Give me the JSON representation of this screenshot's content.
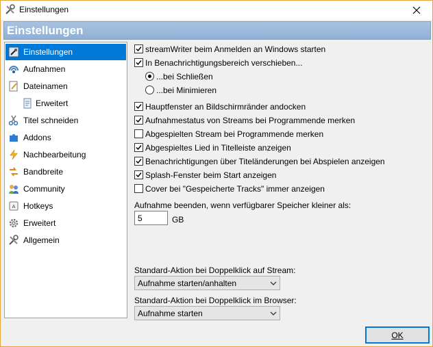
{
  "window": {
    "title": "Einstellungen",
    "close_label": "Close"
  },
  "banner": {
    "title": "Einstellungen"
  },
  "sidebar": {
    "items": [
      {
        "label": "Einstellungen",
        "icon": "settings-icon",
        "selected": true
      },
      {
        "label": "Aufnahmen",
        "icon": "recording-icon"
      },
      {
        "label": "Dateinamen",
        "icon": "filename-icon"
      },
      {
        "label": "Erweitert",
        "icon": "advanced-file-icon",
        "sub": true
      },
      {
        "label": "Titel schneiden",
        "icon": "scissors-icon"
      },
      {
        "label": "Addons",
        "icon": "puzzle-icon"
      },
      {
        "label": "Nachbearbeitung",
        "icon": "lightning-icon"
      },
      {
        "label": "Bandbreite",
        "icon": "bandwidth-icon"
      },
      {
        "label": "Community",
        "icon": "community-icon"
      },
      {
        "label": "Hotkeys",
        "icon": "hotkey-icon"
      },
      {
        "label": "Erweitert",
        "icon": "gear-icon"
      },
      {
        "label": "Allgemein",
        "icon": "tools-icon"
      }
    ]
  },
  "options": {
    "start_on_login": {
      "label": "streamWriter beim Anmelden an Windows starten",
      "checked": true
    },
    "tray": {
      "label": "In Benachrichtigungsbereich verschieben...",
      "checked": true
    },
    "tray_close": {
      "label": "...bei Schließen",
      "selected": true
    },
    "tray_minimize": {
      "label": "...bei Minimieren",
      "selected": false
    },
    "dock": {
      "label": "Hauptfenster an Bildschirmränder andocken",
      "checked": true
    },
    "remember_status": {
      "label": "Aufnahmestatus von Streams bei Programmende merken",
      "checked": true
    },
    "remember_played": {
      "label": "Abgespielten Stream bei Programmende merken",
      "checked": false
    },
    "title_in_bar": {
      "label": "Abgespieltes Lied in Titelleiste anzeigen",
      "checked": true
    },
    "notify_title": {
      "label": "Benachrichtigungen über Titeländerungen bei Abspielen anzeigen",
      "checked": true
    },
    "splash": {
      "label": "Splash-Fenster beim Start anzeigen",
      "checked": true
    },
    "cover": {
      "label": "Cover bei \"Gespeicherte Tracks\" immer anzeigen",
      "checked": false
    }
  },
  "space": {
    "label": "Aufnahme beenden, wenn verfügbarer Speicher kleiner als:",
    "value": "5",
    "unit": "GB"
  },
  "dblclick_stream": {
    "label": "Standard-Aktion bei Doppelklick auf Stream:",
    "value": "Aufnahme starten/anhalten"
  },
  "dblclick_browser": {
    "label": "Standard-Aktion bei Doppelklick im Browser:",
    "value": "Aufnahme starten"
  },
  "footer": {
    "ok_label": "OK"
  },
  "colors": {
    "accent": "#0078d7",
    "banner": "#9bb9dc",
    "window_border": "#e8a33c"
  }
}
